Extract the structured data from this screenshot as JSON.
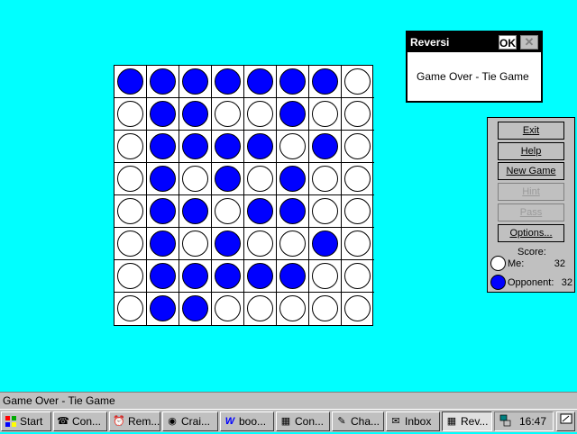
{
  "dialog": {
    "title": "Reversi",
    "ok_label": "OK",
    "close_glyph": "✕",
    "message": "Game Over - Tie Game"
  },
  "board": {
    "rows": [
      [
        "b",
        "b",
        "b",
        "b",
        "b",
        "b",
        "b",
        "w"
      ],
      [
        "w",
        "b",
        "b",
        "w",
        "w",
        "b",
        "w",
        "w"
      ],
      [
        "w",
        "b",
        "b",
        "b",
        "b",
        "w",
        "b",
        "w"
      ],
      [
        "w",
        "b",
        "w",
        "b",
        "w",
        "b",
        "w",
        "w"
      ],
      [
        "w",
        "b",
        "b",
        "w",
        "b",
        "b",
        "w",
        "w"
      ],
      [
        "w",
        "b",
        "w",
        "b",
        "w",
        "w",
        "b",
        "w"
      ],
      [
        "w",
        "b",
        "b",
        "b",
        "b",
        "b",
        "w",
        "w"
      ],
      [
        "w",
        "b",
        "b",
        "w",
        "w",
        "w",
        "w",
        "w"
      ]
    ]
  },
  "panel": {
    "buttons": {
      "exit": "Exit",
      "help": "Help",
      "new_game": "New Game",
      "hint": "Hint",
      "pass": "Pass",
      "options": "Options..."
    },
    "score_label": "Score:",
    "me_label": "Me:",
    "me_score": "32",
    "opponent_label": "Opponent:",
    "opponent_score": "32"
  },
  "status_bar": {
    "text": "Game Over - Tie Game"
  },
  "taskbar": {
    "start_label": "Start",
    "items": [
      {
        "label": "Con...",
        "icon": "contacts-icon"
      },
      {
        "label": "Rem...",
        "icon": "reminder-icon"
      },
      {
        "label": "Crai...",
        "icon": "globe-icon"
      },
      {
        "label": "boo...",
        "icon": "word-icon"
      },
      {
        "label": "Con...",
        "icon": "calendar-icon"
      },
      {
        "label": "Cha...",
        "icon": "chat-icon"
      },
      {
        "label": "Inbox",
        "icon": "inbox-icon"
      },
      {
        "label": "Rev...",
        "icon": "reversi-icon"
      }
    ],
    "clock": "16:47"
  },
  "colors": {
    "background": "#00FFFF",
    "player_disc": "#FFFFFF",
    "opponent_disc": "#0000FF"
  }
}
